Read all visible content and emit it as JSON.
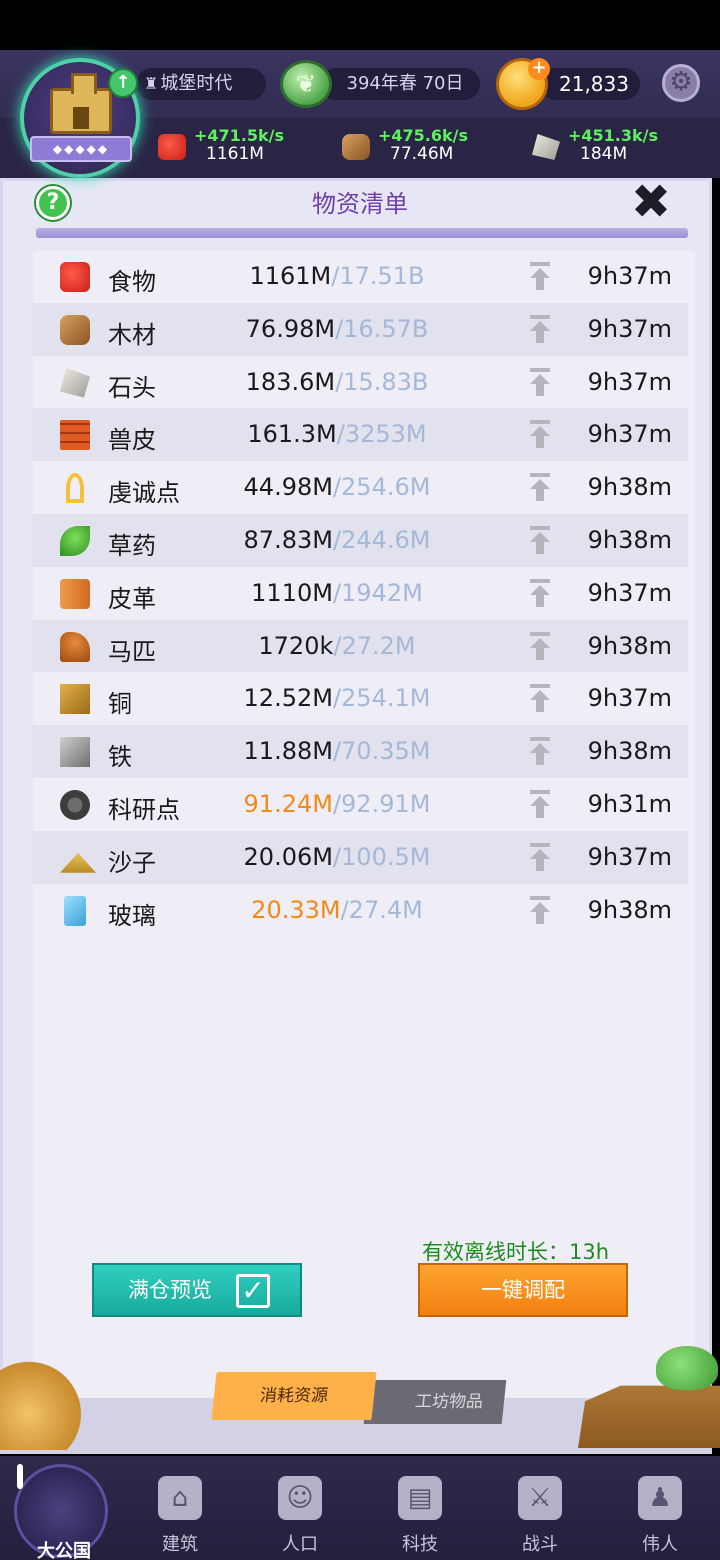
{
  "header": {
    "era_label": "城堡时代",
    "date_label": "394年春 70日",
    "coins": "21,833",
    "resources": [
      {
        "name": "food",
        "rate": "+471.5k/s",
        "amount": "1161M"
      },
      {
        "name": "wood",
        "rate": "+475.6k/s",
        "amount": "77.46M"
      },
      {
        "name": "stone",
        "rate": "+451.3k/s",
        "amount": "184M"
      }
    ]
  },
  "panel": {
    "title": "物资清单",
    "help": "?",
    "close": "✖",
    "rows": [
      {
        "icon": "apple-icon",
        "name": "食物",
        "current": "1161M",
        "capacity": "/17.51B",
        "time": "9h37m",
        "warn": false
      },
      {
        "icon": "wood-icon",
        "name": "木材",
        "current": "76.98M",
        "capacity": "/16.57B",
        "time": "9h37m",
        "warn": false
      },
      {
        "icon": "stone-icon",
        "name": "石头",
        "current": "183.6M",
        "capacity": "/15.83B",
        "time": "9h37m",
        "warn": false
      },
      {
        "icon": "hide-icon",
        "name": "兽皮",
        "current": "161.3M",
        "capacity": "/3253M",
        "time": "9h37m",
        "warn": false
      },
      {
        "icon": "ankh-icon",
        "name": "虔诚点",
        "current": "44.98M",
        "capacity": "/254.6M",
        "time": "9h38m",
        "warn": false
      },
      {
        "icon": "herb-icon",
        "name": "草药",
        "current": "87.83M",
        "capacity": "/244.6M",
        "time": "9h38m",
        "warn": false
      },
      {
        "icon": "leather-icon",
        "name": "皮革",
        "current": "1110M",
        "capacity": "/1942M",
        "time": "9h37m",
        "warn": false
      },
      {
        "icon": "horse-icon",
        "name": "马匹",
        "current": "1720k",
        "capacity": "/27.2M",
        "time": "9h38m",
        "warn": false
      },
      {
        "icon": "copper-icon",
        "name": "铜",
        "current": "12.52M",
        "capacity": "/254.1M",
        "time": "9h37m",
        "warn": false
      },
      {
        "icon": "iron-icon",
        "name": "铁",
        "current": "11.88M",
        "capacity": "/70.35M",
        "time": "9h38m",
        "warn": false
      },
      {
        "icon": "gears-icon",
        "name": "科研点",
        "current": "91.24M",
        "capacity": "/92.91M",
        "time": "9h31m",
        "warn": true
      },
      {
        "icon": "sand-icon",
        "name": "沙子",
        "current": "20.06M",
        "capacity": "/100.5M",
        "time": "9h37m",
        "warn": false
      },
      {
        "icon": "glass-icon",
        "name": "玻璃",
        "current": "20.33M",
        "capacity": "/27.4M",
        "time": "9h38m",
        "warn": true
      }
    ],
    "offline_label": "有效离线时长：13h",
    "preview_button": "满仓预览",
    "allocate_button": "一键调配",
    "tab_consume": "消耗资源",
    "tab_workshop": "工坊物品"
  },
  "nav": [
    {
      "label": "大公国",
      "icon": "kingdom-icon"
    },
    {
      "label": "建筑",
      "icon": "house-icon"
    },
    {
      "label": "人口",
      "icon": "person-icon"
    },
    {
      "label": "科技",
      "icon": "book-icon"
    },
    {
      "label": "战斗",
      "icon": "swords-icon"
    },
    {
      "label": "伟人",
      "icon": "statue-icon"
    }
  ],
  "colors": {
    "warn": "#f08a1b",
    "capacity": "#a4b8d8",
    "title": "#6e3fa6",
    "rate": "#5cf25c"
  }
}
